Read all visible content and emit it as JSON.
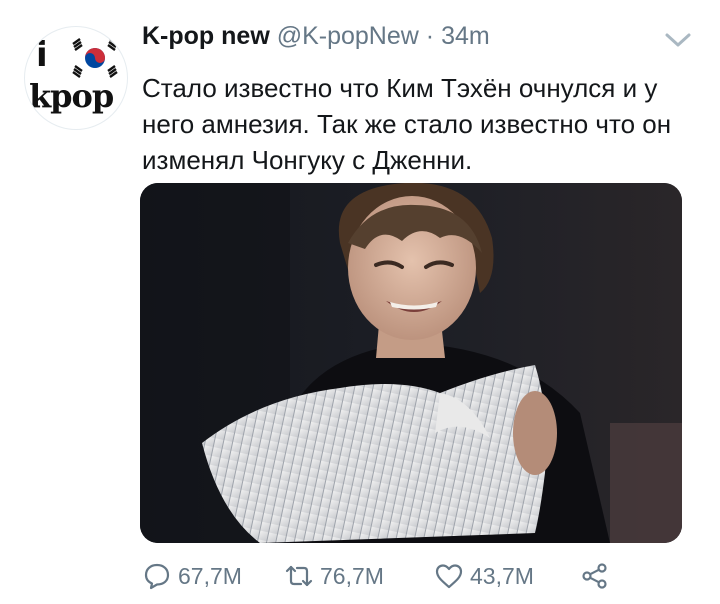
{
  "tweet": {
    "display_name": "K-pop new",
    "handle": "@K-popNew",
    "separator": "·",
    "time": "34m",
    "text": "Стало известно что Ким Тэхён очнулся и у него амнезия. Так же стало известно что он изменял Чонгуку с Дженни.",
    "avatar": {
      "logo_top": "i",
      "logo_bottom": "kpop",
      "flag": "south-korea-flag"
    }
  },
  "actions": {
    "reply_count": "67,7M",
    "retweet_count": "76,7M",
    "like_count": "43,7M"
  },
  "icons": {
    "menu": "chevron-down-icon",
    "reply": "reply-icon",
    "retweet": "retweet-icon",
    "like": "heart-icon",
    "share": "share-icon"
  },
  "colors": {
    "text": "#14171a",
    "secondary": "#657786",
    "flag_red": "#cd2e3a",
    "flag_blue": "#0047a0"
  }
}
